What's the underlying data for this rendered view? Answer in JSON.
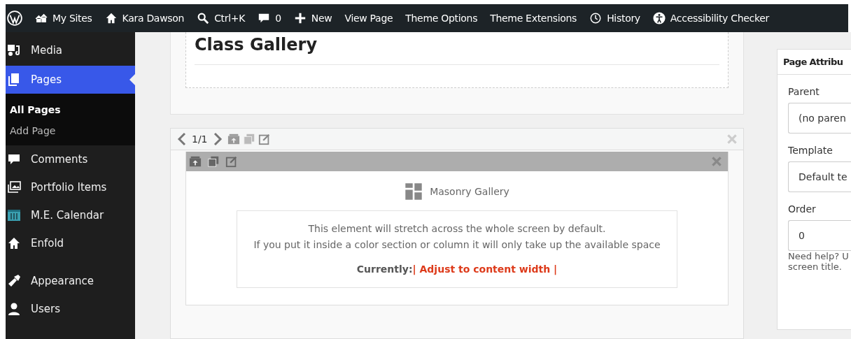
{
  "admin_bar": {
    "items": [
      {
        "kind": "wp"
      },
      {
        "kind": "sites",
        "label": "My Sites"
      },
      {
        "kind": "home",
        "label": "Kara Dawson"
      },
      {
        "kind": "search",
        "label": "Ctrl+K"
      },
      {
        "kind": "comment",
        "label": "0"
      },
      {
        "kind": "plus",
        "label": "New"
      },
      {
        "kind": "text",
        "label": "View Page"
      },
      {
        "kind": "text",
        "label": "Theme Options"
      },
      {
        "kind": "text",
        "label": "Theme Extensions"
      },
      {
        "kind": "history",
        "label": "History"
      },
      {
        "kind": "access",
        "label": "Accessibility Checker"
      }
    ]
  },
  "sidebar": {
    "items": [
      {
        "kind": "media",
        "label": "Media",
        "selected": false
      },
      {
        "kind": "pages",
        "label": "Pages",
        "selected": true,
        "children": [
          {
            "label": "All Pages",
            "selected": true
          },
          {
            "label": "Add Page",
            "selected": false
          }
        ]
      },
      {
        "kind": "comment",
        "label": "Comments",
        "selected": false
      },
      {
        "kind": "portfolio",
        "label": "Portfolio Items",
        "selected": false
      },
      {
        "kind": "calendar",
        "label": "M.E. Calendar",
        "selected": false
      },
      {
        "kind": "home",
        "label": "Enfold",
        "selected": false
      },
      {
        "kind": "brush",
        "label": "Appearance",
        "selected": false
      },
      {
        "kind": "user",
        "label": "Users",
        "selected": false
      }
    ]
  },
  "title_box": {
    "title": "Class Gallery"
  },
  "element": {
    "pager": "1/1",
    "inner": {
      "name": "Masonry Gallery",
      "notice": [
        "This element will stretch across the whole screen by default.",
        "If you put it inside a color section or column it will only take up the available space"
      ],
      "current_label": "Currently:",
      "current_value": "| Adjust to content width |"
    }
  },
  "page_attributes": {
    "title": "Page Attribu",
    "fields": [
      {
        "label": "Parent",
        "value": "(no paren"
      },
      {
        "label": "Template",
        "value": "Default te"
      },
      {
        "label": "Order",
        "value": "0"
      }
    ],
    "help": [
      "Need help? U",
      "screen title."
    ]
  }
}
